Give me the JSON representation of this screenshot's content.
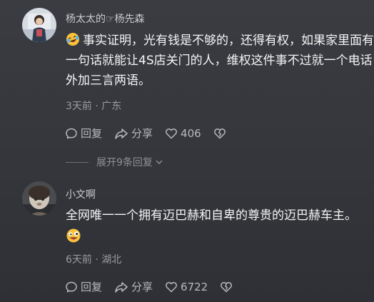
{
  "comments": [
    {
      "username": "杨太太的☞杨先森",
      "text_lines": [
        "事实证明，光有钱是不够的，还得有权，如果家里面有",
        "一句话就能让4S店关门的人，维权这件事不过就一个电话",
        "外加三言两语。"
      ],
      "leading_emoji": "laughing-tears-emoji",
      "time": "3天前",
      "separator": "·",
      "location": "广东",
      "actions": {
        "reply": "回复",
        "share": "分享",
        "likes": "406"
      },
      "expand_replies": "展开9条回复"
    },
    {
      "username": "小文啊",
      "text_lines": [
        "全网唯一一个拥有迈巴赫和自卑的尊贵的迈巴赫车主。"
      ],
      "trailing_emoji": "crazy-face-emoji",
      "time": "6天前",
      "separator": "·",
      "location": "湖北",
      "actions": {
        "reply": "回复",
        "share": "分享",
        "likes": "6722"
      }
    }
  ],
  "colors": {
    "background": "#36383d",
    "primary_text": "#f5f5f5",
    "secondary_text": "#9a9ca1",
    "username": "#c9cacd",
    "emoji_yellow": "#f9c23c"
  },
  "icons": [
    "comment-bubble-icon",
    "share-arrow-icon",
    "heart-icon",
    "broken-heart-icon",
    "chevron-down-icon"
  ]
}
